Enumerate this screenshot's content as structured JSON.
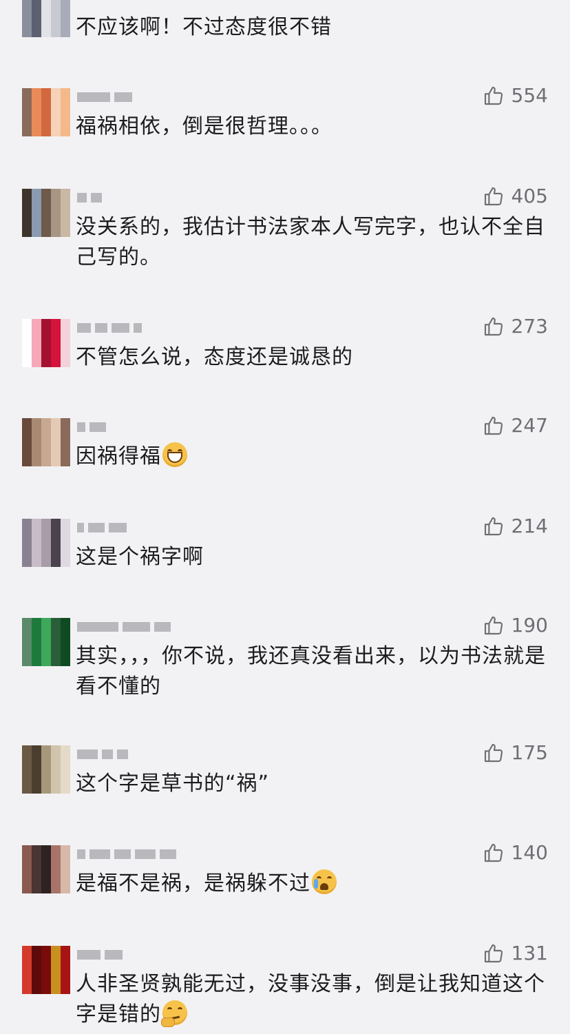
{
  "comments": [
    {
      "text": "不应该啊！不过态度很不错",
      "likes": "",
      "avatar_colors": [
        "#8a8f9c",
        "#c8cad2",
        "#5c6172",
        "#a8acb8",
        "#e2e3e8"
      ]
    },
    {
      "text": "福祸相依，倒是很哲理。。。",
      "likes": "554",
      "avatar_colors": [
        "#e88a5a",
        "#f4b98a",
        "#d2683e",
        "#8a6a5a",
        "#f6d2b8"
      ]
    },
    {
      "text": "没关系的，我估计书法家本人写完字，也认不全自己写的。",
      "likes": "405",
      "avatar_colors": [
        "#6e5a4a",
        "#3e342c",
        "#a89684",
        "#8a9ab0",
        "#c8b8a4"
      ]
    },
    {
      "text": "不管怎么说，态度还是诚恳的",
      "likes": "273",
      "avatar_colors": [
        "#d4143c",
        "#f6a8b8",
        "#f4d2da",
        "#a41030",
        "#ffffff"
      ]
    },
    {
      "text": "因祸得福",
      "likes": "247",
      "emoji": "grin",
      "avatar_colors": [
        "#8a6a5a",
        "#c8a890",
        "#6a4a3a",
        "#e4cab4",
        "#a88a74"
      ]
    },
    {
      "text": "这是个祸字啊",
      "likes": "214",
      "avatar_colors": [
        "#8a8290",
        "#4a424e",
        "#c8bcc8",
        "#e0d8e0",
        "#a89ca8"
      ]
    },
    {
      "text": "其实，，，你不说，我还真没看出来，以为书法就是看不懂的",
      "likes": "190",
      "avatar_colors": [
        "#1e7a3c",
        "#0e4a22",
        "#3ea85a",
        "#5a8a6a",
        "#2a5e38"
      ]
    },
    {
      "text": "这个字是草书的“祸”",
      "likes": "175",
      "avatar_colors": [
        "#a8987a",
        "#6a5a44",
        "#d0c4ac",
        "#4a3e2e",
        "#e4dac8"
      ]
    },
    {
      "text": "是福不是祸，是祸躲不过",
      "likes": "140",
      "emoji": "cry",
      "avatar_colors": [
        "#a8746a",
        "#4a3434",
        "#d8b8a8",
        "#2e2222",
        "#8a5a50"
      ]
    },
    {
      "text": "人非圣贤孰能无过，没事没事，倒是让我知道这个字是错的",
      "likes": "131",
      "emoji": "think",
      "avatar_colors": [
        "#a81414",
        "#7a0a0a",
        "#d43a2a",
        "#c8901e",
        "#5e0a0a"
      ]
    }
  ]
}
